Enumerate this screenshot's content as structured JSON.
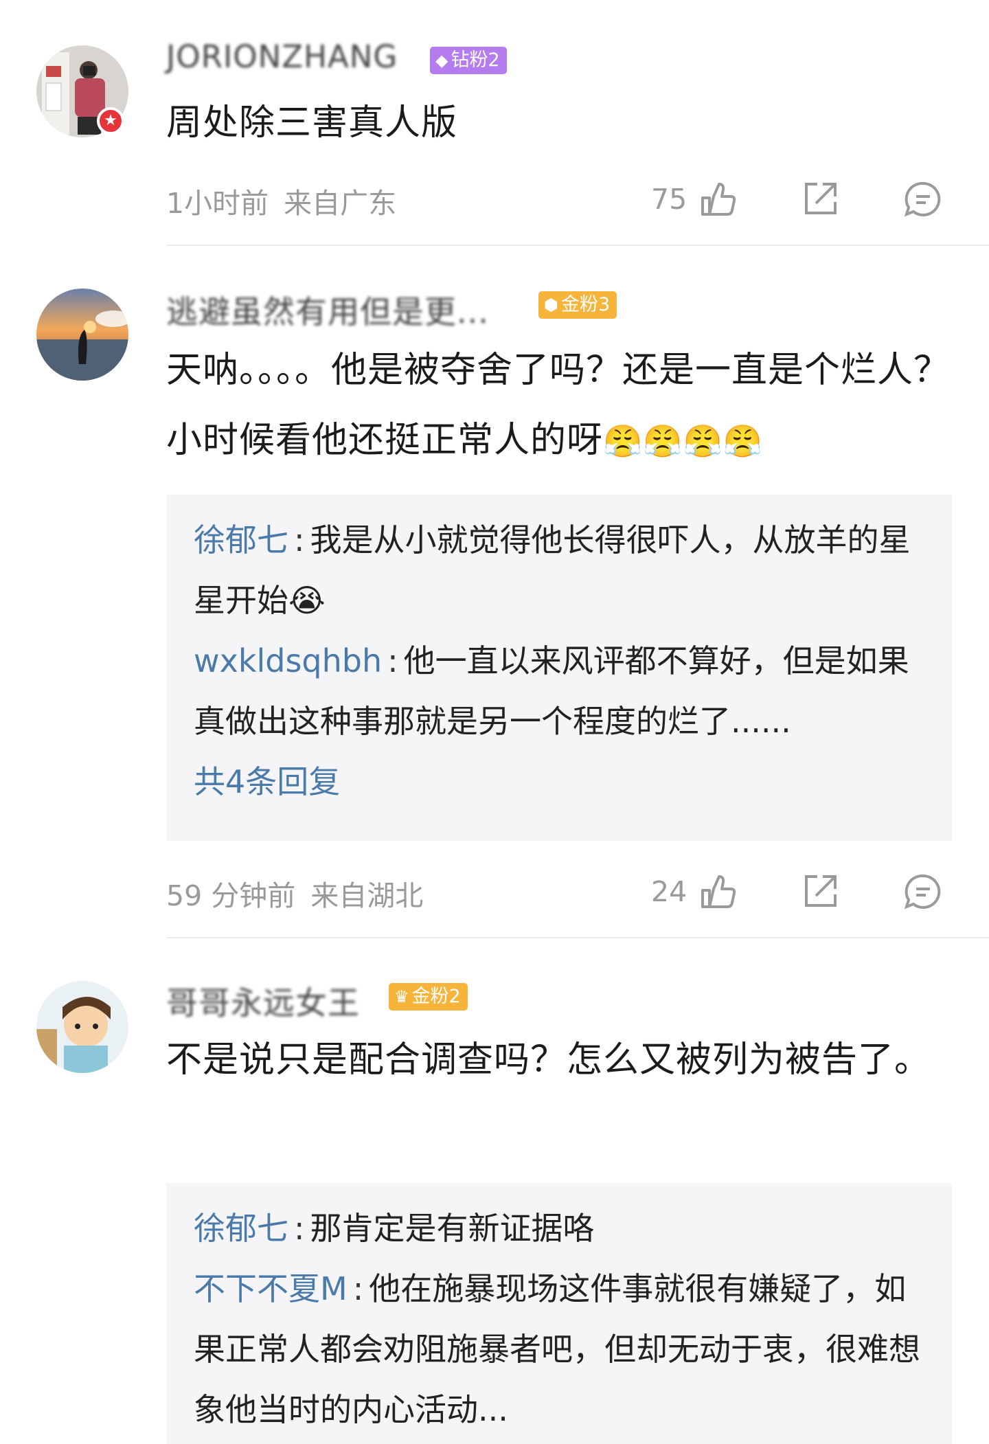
{
  "comments": [
    {
      "username": "JORIONZHANG",
      "badge": {
        "label": "钻粉2",
        "icon": "diamond-icon",
        "color": "#b57cf0"
      },
      "verified_badge": "star-icon",
      "text": "周处除三害真人版",
      "time": "1小时前",
      "location": "来自广东",
      "likes": "75"
    },
    {
      "username": "逃避虽然有用但是更...",
      "badge": {
        "label": "金粉3",
        "icon": "gold-gem-icon",
        "color": "#f6b43a"
      },
      "text": "天呐。。。。他是被夺舍了吗？还是一直是个烂人？小时候看他还挺正常人的呀",
      "emojis": [
        "😤",
        "😤",
        "😤",
        "😤"
      ],
      "replies": [
        {
          "name": "徐郁七",
          "text": "我是从小就觉得他长得很吓人，从放羊的星星开始",
          "emoji": "😭"
        },
        {
          "name": "wxkldsqhbh",
          "text": "他一直以来风评都不算好，但是如果真做出这种事那就是另一个程度的烂了......"
        }
      ],
      "more_replies": "共4条回复",
      "time": "59 分钟前",
      "location": "来自湖北",
      "likes": "24"
    },
    {
      "username": "哥哥永远女王",
      "badge": {
        "label": "金粉2",
        "icon": "crown-icon",
        "color": "#f6b43a"
      },
      "text": "不是说只是配合调查吗？怎么又被列为被告了。",
      "replies": [
        {
          "name": "徐郁七",
          "text": "那肯定是有新证据咯"
        },
        {
          "name": "不下不夏M",
          "text": "他在施暴现场这件事就很有嫌疑了，如果正常人都会劝阻施暴者吧，但却无动于衷，很难想象他当时的内心活动..."
        }
      ]
    }
  ],
  "colors": {
    "link": "#4a7aaa",
    "meta": "#9a9a9a",
    "reply_bg": "#f5f5f7",
    "verified": "#e5343a"
  }
}
